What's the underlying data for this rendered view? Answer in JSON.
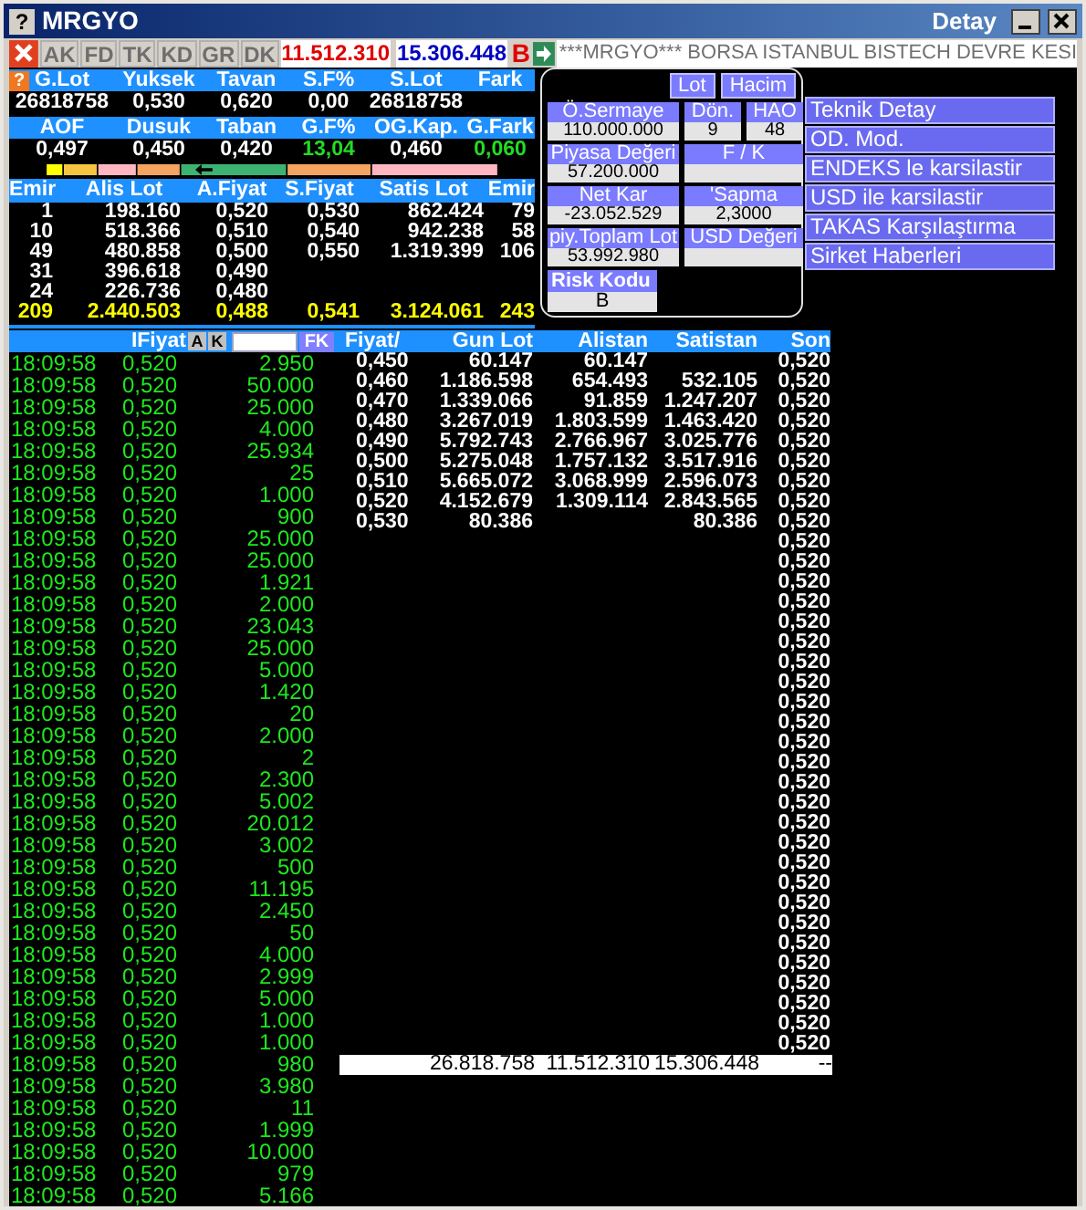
{
  "window": {
    "help_glyph": "?",
    "title": "MRGYO",
    "detail_title": "Detay"
  },
  "toolbar": {
    "tabs": [
      {
        "label": "AK",
        "disabled": true
      },
      {
        "label": "FD",
        "disabled": true
      },
      {
        "label": "TK",
        "disabled": true
      },
      {
        "label": "KD",
        "disabled": true
      },
      {
        "label": "GR",
        "disabled": true
      },
      {
        "label": "DK",
        "disabled": true
      }
    ],
    "buy_total": "11.512.310",
    "sell_total": "15.306.448",
    "badge": "B",
    "ticker": "***MRGYO*** BORSA ISTANBUL BISTECH DEVRE KESI"
  },
  "summary": {
    "help_glyph": "?",
    "rows": [
      {
        "kind": "header",
        "cells": [
          {
            "text": "G.Lot"
          },
          {
            "text": "Yuksek"
          },
          {
            "text": "Tavan"
          },
          {
            "text": "S.F%"
          },
          {
            "text": "S.Lot"
          },
          {
            "text": "Fark"
          }
        ]
      },
      {
        "kind": "values",
        "cells": [
          {
            "text": "26818758",
            "positive": false
          },
          {
            "text": "0,530",
            "positive": false
          },
          {
            "text": "0,620",
            "positive": false
          },
          {
            "text": "0,00",
            "positive": false
          },
          {
            "text": "26818758",
            "positive": false
          }
        ]
      },
      {
        "kind": "header",
        "cells": [
          {
            "text": "AOF"
          },
          {
            "text": "Dusuk"
          },
          {
            "text": "Taban"
          },
          {
            "text": "G.F%"
          },
          {
            "text": "OG.Kap."
          },
          {
            "text": "G.Fark"
          }
        ]
      },
      {
        "kind": "values",
        "cells": [
          {
            "text": "0,497",
            "positive": false
          },
          {
            "text": "0,450",
            "positive": false
          },
          {
            "text": "0,420",
            "positive": false
          },
          {
            "text": "13,04",
            "positive": true
          },
          {
            "text": "0,460",
            "positive": false
          },
          {
            "text": "0,060",
            "positive": true
          }
        ]
      }
    ]
  },
  "order_book": {
    "columns": [
      "Emir",
      "Alis Lot",
      "A.Fiyat",
      "S.Fiyat",
      "Satis Lot",
      "Emir"
    ],
    "rows": [
      {
        "kind": "level",
        "cells": [
          "1",
          "198.160",
          "0,520",
          "0,530",
          "862.424",
          "79"
        ]
      },
      {
        "kind": "level",
        "cells": [
          "10",
          "518.366",
          "0,510",
          "0,540",
          "942.238",
          "58"
        ]
      },
      {
        "kind": "level",
        "cells": [
          "49",
          "480.858",
          "0,500",
          "0,550",
          "1.319.399",
          "106"
        ]
      },
      {
        "kind": "level",
        "cells": [
          "31",
          "396.618",
          "0,490"
        ]
      },
      {
        "kind": "level",
        "cells": [
          "24",
          "226.736",
          "0,480"
        ]
      },
      {
        "kind": "total",
        "cells": [
          "209",
          "2.440.503",
          "0,488",
          "0,541",
          "3.124.061",
          "243"
        ]
      }
    ]
  },
  "info_panel": {
    "toggles": [
      "Lot",
      "Hacim"
    ],
    "rows": [
      [
        {
          "label": "Ö.Sermaye",
          "value": "110.000.000"
        },
        {
          "label": "Dön.",
          "value": "9"
        },
        {
          "label": "HAO",
          "value": "48"
        }
      ],
      [
        {
          "label": "Piyasa Değeri",
          "value": "57.200.000"
        },
        {
          "label": "F / K"
        }
      ],
      [
        {
          "label": "Net Kar",
          "value": "-23.052.529"
        },
        {
          "label": "'Sapma",
          "value": "2,3000"
        }
      ],
      [
        {
          "label": "piy.Toplam Lot",
          "value": "53.992.980"
        },
        {
          "label": "USD Değeri"
        }
      ]
    ],
    "risk": {
      "label": "Risk Kodu",
      "value": "B"
    }
  },
  "links": [
    "Teknik Detay",
    "OD. Mod.",
    "ENDEKS le karsilastir",
    "USD ile karsilastir",
    "TAKAS Karşılaştırma",
    "Sirket Haberleri"
  ],
  "trades": {
    "header": "IFiyat",
    "buttons": [
      "A",
      "K"
    ],
    "filter_button": "FK",
    "rows": [
      [
        "18:09:58",
        "0,520",
        "2.950"
      ],
      [
        "18:09:58",
        "0,520",
        "50.000"
      ],
      [
        "18:09:58",
        "0,520",
        "25.000"
      ],
      [
        "18:09:58",
        "0,520",
        "4.000"
      ],
      [
        "18:09:58",
        "0,520",
        "25.934"
      ],
      [
        "18:09:58",
        "0,520",
        "25"
      ],
      [
        "18:09:58",
        "0,520",
        "1.000"
      ],
      [
        "18:09:58",
        "0,520",
        "900"
      ],
      [
        "18:09:58",
        "0,520",
        "25.000"
      ],
      [
        "18:09:58",
        "0,520",
        "25.000"
      ],
      [
        "18:09:58",
        "0,520",
        "1.921"
      ],
      [
        "18:09:58",
        "0,520",
        "2.000"
      ],
      [
        "18:09:58",
        "0,520",
        "23.043"
      ],
      [
        "18:09:58",
        "0,520",
        "25.000"
      ],
      [
        "18:09:58",
        "0,520",
        "5.000"
      ],
      [
        "18:09:58",
        "0,520",
        "1.420"
      ],
      [
        "18:09:58",
        "0,520",
        "20"
      ],
      [
        "18:09:58",
        "0,520",
        "2.000"
      ],
      [
        "18:09:58",
        "0,520",
        "2"
      ],
      [
        "18:09:58",
        "0,520",
        "2.300"
      ],
      [
        "18:09:58",
        "0,520",
        "5.002"
      ],
      [
        "18:09:58",
        "0,520",
        "20.012"
      ],
      [
        "18:09:58",
        "0,520",
        "3.002"
      ],
      [
        "18:09:58",
        "0,520",
        "500"
      ],
      [
        "18:09:58",
        "0,520",
        "11.195"
      ],
      [
        "18:09:58",
        "0,520",
        "2.450"
      ],
      [
        "18:09:58",
        "0,520",
        "50"
      ],
      [
        "18:09:58",
        "0,520",
        "4.000"
      ],
      [
        "18:09:58",
        "0,520",
        "2.999"
      ],
      [
        "18:09:58",
        "0,520",
        "5.000"
      ],
      [
        "18:09:58",
        "0,520",
        "1.000"
      ],
      [
        "18:09:58",
        "0,520",
        "1.000"
      ],
      [
        "18:09:58",
        "0,520",
        "980"
      ],
      [
        "18:09:58",
        "0,520",
        "3.980"
      ],
      [
        "18:09:58",
        "0,520",
        "11"
      ],
      [
        "18:09:58",
        "0,520",
        "1.999"
      ],
      [
        "18:09:58",
        "0,520",
        "10.000"
      ],
      [
        "18:09:58",
        "0,520",
        "979"
      ],
      [
        "18:09:58",
        "0,520",
        "5.166"
      ]
    ]
  },
  "price_table": {
    "columns": [
      "Fiyat/",
      "Gun Lot",
      "Alistan",
      "Satistan",
      "Son"
    ],
    "rows": [
      {
        "fiyat": "0,450",
        "gun_lot": "60.147",
        "alistan": "60.147",
        "son": "0,520"
      },
      {
        "fiyat": "0,460",
        "gun_lot": "1.186.598",
        "alistan": "654.493",
        "satistan": "532.105",
        "son": "0,520"
      },
      {
        "fiyat": "0,470",
        "gun_lot": "1.339.066",
        "alistan": "91.859",
        "satistan": "1.247.207",
        "son": "0,520"
      },
      {
        "fiyat": "0,480",
        "gun_lot": "3.267.019",
        "alistan": "1.803.599",
        "satistan": "1.463.420",
        "son": "0,520"
      },
      {
        "fiyat": "0,490",
        "gun_lot": "5.792.743",
        "alistan": "2.766.967",
        "satistan": "3.025.776",
        "son": "0,520"
      },
      {
        "fiyat": "0,500",
        "gun_lot": "5.275.048",
        "alistan": "1.757.132",
        "satistan": "3.517.916",
        "son": "0,520"
      },
      {
        "fiyat": "0,510",
        "gun_lot": "5.665.072",
        "alistan": "3.068.999",
        "satistan": "2.596.073",
        "son": "0,520"
      },
      {
        "fiyat": "0,520",
        "gun_lot": "4.152.679",
        "alistan": "1.309.114",
        "satistan": "2.843.565",
        "son": "0,520"
      },
      {
        "fiyat": "0,530",
        "gun_lot": "80.386",
        "satistan": "80.386",
        "son": "0,520"
      },
      {
        "son": "0,520"
      },
      {
        "son": "0,520"
      },
      {
        "son": "0,520"
      },
      {
        "son": "0,520"
      },
      {
        "son": "0,520"
      },
      {
        "son": "0,520"
      },
      {
        "son": "0,520"
      },
      {
        "son": "0,520"
      },
      {
        "son": "0,520"
      },
      {
        "son": "0,520"
      },
      {
        "son": "0,520"
      },
      {
        "son": "0,520"
      },
      {
        "son": "0,520"
      },
      {
        "son": "0,520"
      },
      {
        "son": "0,520"
      },
      {
        "son": "0,520"
      },
      {
        "son": "0,520"
      },
      {
        "son": "0,520"
      },
      {
        "son": "0,520"
      },
      {
        "son": "0,520"
      },
      {
        "son": "0,520"
      },
      {
        "son": "0,520"
      },
      {
        "son": "0,520"
      },
      {
        "son": "0,520"
      },
      {
        "son": "0,520"
      },
      {
        "son": "0,520"
      }
    ],
    "totals": {
      "gun_lot": "26.818.758",
      "alistan": "11.512.310",
      "satistan": "15.306.448",
      "son": "--"
    }
  }
}
